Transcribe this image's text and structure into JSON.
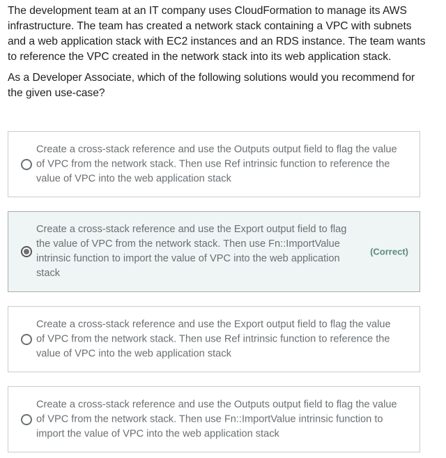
{
  "question": {
    "paragraphs": [
      "The development team at an IT company uses CloudFormation to manage its AWS infrastructure. The team has created a network stack containing a VPC with subnets and a web application stack with EC2 instances and an RDS instance. The team wants to reference the VPC created in the network stack into its web application stack.",
      "As a Developer Associate, which of the following solutions would you recommend for the given use-case?"
    ]
  },
  "options": [
    {
      "text": "Create a cross-stack reference and use the Outputs output field to flag the value of VPC from the network stack. Then use Ref intrinsic function to reference the value of VPC into the web application stack",
      "selected": false,
      "tag": ""
    },
    {
      "text": "Create a cross-stack reference and use the Export output field to flag the value of VPC from the network stack. Then use Fn::ImportValue intrinsic function to import the value of VPC into the web application stack",
      "selected": true,
      "tag": "(Correct)"
    },
    {
      "text": "Create a cross-stack reference and use the Export output field to flag the value of VPC from the network stack. Then use Ref intrinsic function to reference the value of VPC into the web application stack",
      "selected": false,
      "tag": ""
    },
    {
      "text": "Create a cross-stack reference and use the Outputs output field to flag the value of VPC from the network stack. Then use Fn::ImportValue intrinsic function to import the value of VPC into the web application stack",
      "selected": false,
      "tag": ""
    }
  ],
  "colors": {
    "correct_bg": "#eff5f4",
    "correct_tag": "#5c8a7d"
  }
}
